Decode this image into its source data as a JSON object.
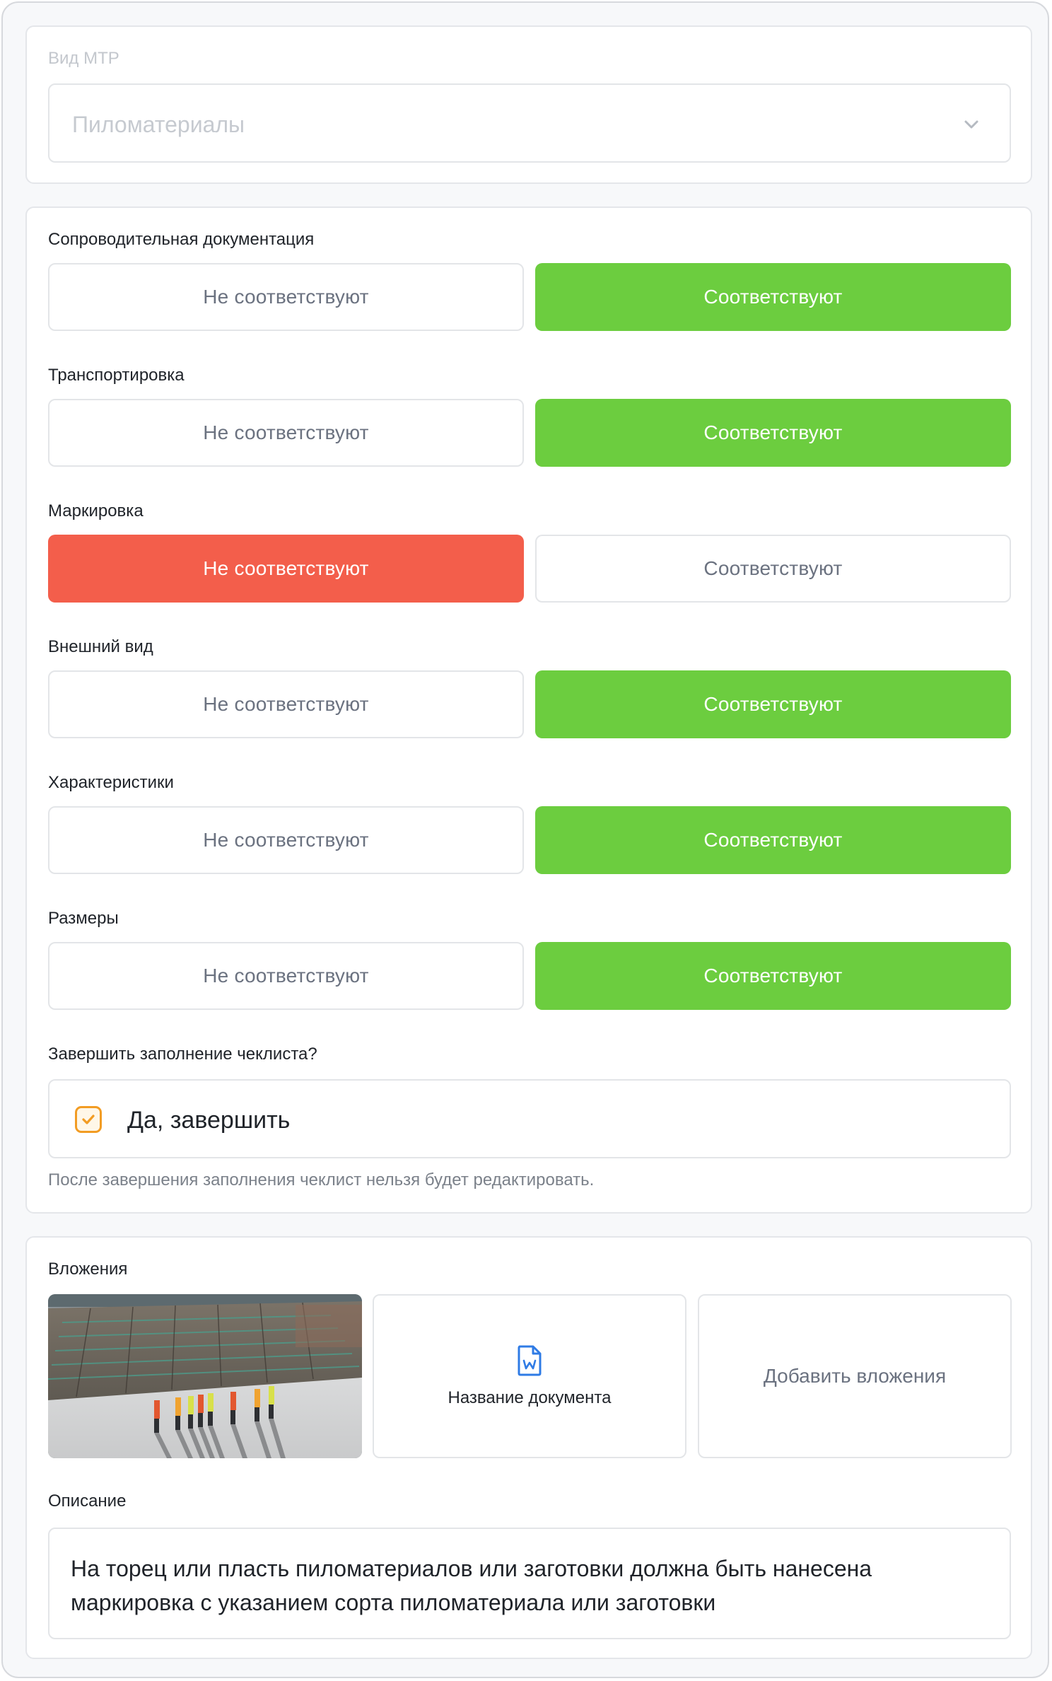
{
  "material_type": {
    "label": "Вид МТР",
    "value": "Пиломатериалы",
    "icon": "chevron-down-icon"
  },
  "checklist": {
    "option_no": "Не соответствуют",
    "option_yes": "Соответствуют",
    "items": [
      {
        "label": "Сопроводительная документация",
        "selected": "yes"
      },
      {
        "label": "Транспортировка",
        "selected": "yes"
      },
      {
        "label": "Маркировка",
        "selected": "no"
      },
      {
        "label": "Внешний вид",
        "selected": "yes"
      },
      {
        "label": "Характеристики",
        "selected": "yes"
      },
      {
        "label": "Размеры",
        "selected": "yes"
      }
    ],
    "colors": {
      "yes": "#6ccd3f",
      "no": "#f35e4b"
    }
  },
  "finish": {
    "label": "Завершить заполнение чеклиста?",
    "checkbox_label": "Да, завершить",
    "checked": true,
    "hint": "После завершения заполнения чеклист нельзя будет редактировать."
  },
  "attachments": {
    "label": "Вложения",
    "document_name": "Название документа",
    "document_icon": "word-document-icon",
    "add_label": "Добавить вложения"
  },
  "description": {
    "label": "Описание",
    "text": "На торец или пласть пиломатериалов или заготовки должна быть нанесена маркировка с указанием сорта пиломатериала или заготовки"
  }
}
